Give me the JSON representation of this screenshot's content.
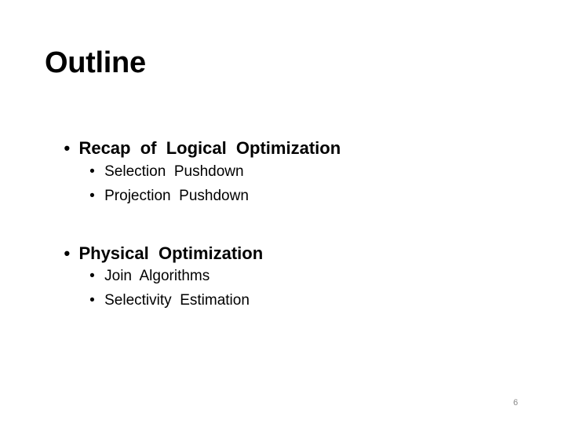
{
  "slide": {
    "title": "Outline",
    "bullet_glyph": "•",
    "sections": [
      {
        "label": "Recap  of  Logical  Optimization",
        "items": [
          "Selection  Pushdown",
          "Projection  Pushdown"
        ]
      },
      {
        "label": "Physical  Optimization",
        "items": [
          "Join  Algorithms",
          "Selectivity  Estimation"
        ]
      }
    ],
    "page_number": "6"
  }
}
